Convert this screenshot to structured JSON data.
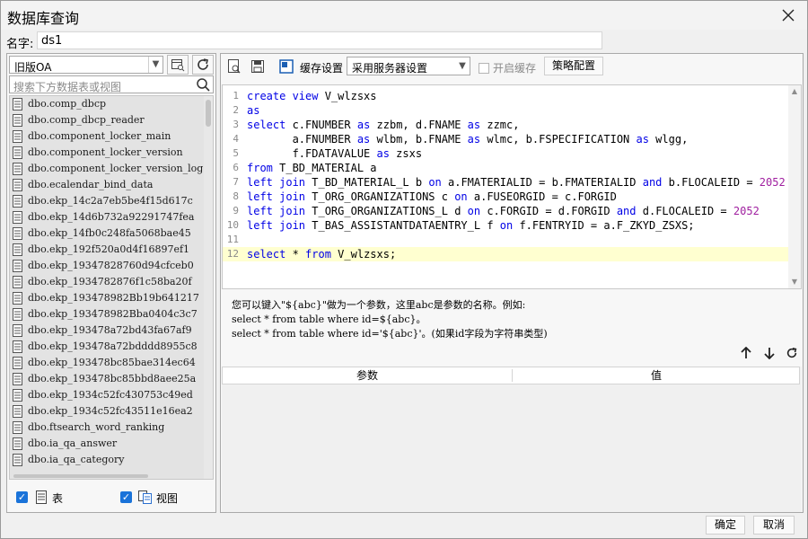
{
  "window": {
    "title": "数据库查询"
  },
  "name_field": {
    "label": "名字:",
    "value": "ds1"
  },
  "left_panel": {
    "db_select": "旧版OA",
    "search_placeholder": "搜索下方数据表或视图",
    "tables": [
      "dbo.comp_dbcp",
      "dbo.comp_dbcp_reader",
      "dbo.component_locker_main",
      "dbo.component_locker_version",
      "dbo.component_locker_version_log",
      "dbo.ecalendar_bind_data",
      "dbo.ekp_14c2a7eb5be4f15d617c",
      "dbo.ekp_14d6b732a92291747fea",
      "dbo.ekp_14fb0c248fa5068bae45",
      "dbo.ekp_192f520a0d4f16897ef1",
      "dbo.ekp_19347828760d94cfceb0",
      "dbo.ekp_1934782876f1c58ba20f",
      "dbo.ekp_193478982Bb19b641217",
      "dbo.ekp_193478982Bba0404c3c7",
      "dbo.ekp_193478a72bd43fa67af9",
      "dbo.ekp_193478a72bdddd8955c8",
      "dbo.ekp_193478bc85bae314ec64",
      "dbo.ekp_193478bc85bbd8aee25a",
      "dbo.ekp_1934c52fc430753c49ed",
      "dbo.ekp_1934c52fc43511e16ea2",
      "dbo.ftsearch_word_ranking",
      "dbo.ia_qa_answer",
      "dbo.ia_qa_category"
    ],
    "check_table": "表",
    "check_view": "视图"
  },
  "toolbar": {
    "cache_label": "缓存设置",
    "cache_select": "采用服务器设置",
    "open_cache": "开启缓存",
    "policy_button": "策略配置"
  },
  "editor": {
    "lines": [
      {
        "n": "1",
        "parts": [
          {
            "t": "create view",
            "c": "kw"
          },
          {
            "t": " V_wlzsxs"
          }
        ]
      },
      {
        "n": "2",
        "parts": [
          {
            "t": "as",
            "c": "kw"
          }
        ]
      },
      {
        "n": "3",
        "parts": [
          {
            "t": "select",
            "c": "kw"
          },
          {
            "t": " c.FNUMBER "
          },
          {
            "t": "as",
            "c": "kw"
          },
          {
            "t": " zzbm, d.FNAME "
          },
          {
            "t": "as",
            "c": "kw"
          },
          {
            "t": " zzmc,"
          }
        ]
      },
      {
        "n": "4",
        "parts": [
          {
            "t": "       a.FNUMBER "
          },
          {
            "t": "as",
            "c": "kw"
          },
          {
            "t": " wlbm, b.FNAME "
          },
          {
            "t": "as",
            "c": "kw"
          },
          {
            "t": " wlmc, b.FSPECIFICATION "
          },
          {
            "t": "as",
            "c": "kw"
          },
          {
            "t": " wlgg,"
          }
        ]
      },
      {
        "n": "5",
        "parts": [
          {
            "t": "       f.FDATAVALUE "
          },
          {
            "t": "as",
            "c": "kw"
          },
          {
            "t": " zsxs"
          }
        ]
      },
      {
        "n": "6",
        "parts": [
          {
            "t": "from",
            "c": "kw"
          },
          {
            "t": " T_BD_MATERIAL a"
          }
        ]
      },
      {
        "n": "7",
        "parts": [
          {
            "t": "left join",
            "c": "kw"
          },
          {
            "t": " T_BD_MATERIAL_L b "
          },
          {
            "t": "on",
            "c": "kw"
          },
          {
            "t": " a.FMATERIALID = b.FMATERIALID "
          },
          {
            "t": "and",
            "c": "kw"
          },
          {
            "t": " b.FLOCALEID = "
          },
          {
            "t": "2052",
            "c": "num"
          }
        ]
      },
      {
        "n": "8",
        "parts": [
          {
            "t": "left join",
            "c": "kw"
          },
          {
            "t": " T_ORG_ORGANIZATIONS c "
          },
          {
            "t": "on",
            "c": "kw"
          },
          {
            "t": " a.FUSEORGID = c.FORGID"
          }
        ]
      },
      {
        "n": "9",
        "parts": [
          {
            "t": "left join",
            "c": "kw"
          },
          {
            "t": " T_ORG_ORGANIZATIONS_L d "
          },
          {
            "t": "on",
            "c": "kw"
          },
          {
            "t": " c.FORGID = d.FORGID "
          },
          {
            "t": "and",
            "c": "kw"
          },
          {
            "t": " d.FLOCALEID = "
          },
          {
            "t": "2052",
            "c": "num"
          }
        ]
      },
      {
        "n": "10",
        "parts": [
          {
            "t": "left join",
            "c": "kw"
          },
          {
            "t": " T_BAS_ASSISTANTDATAENTRY_L f "
          },
          {
            "t": "on",
            "c": "kw"
          },
          {
            "t": " f.FENTRYID = a.F_ZKYD_ZSXS;"
          }
        ]
      },
      {
        "n": "11",
        "parts": []
      },
      {
        "n": "12",
        "parts": [
          {
            "t": "select",
            "c": "kw"
          },
          {
            "t": " * "
          },
          {
            "t": "from",
            "c": "kw"
          },
          {
            "t": " V_wlzsxs;"
          }
        ],
        "active": true
      }
    ]
  },
  "help": {
    "line1": "您可以键入\"${abc}\"做为一个参数，这里abc是参数的名称。例如:",
    "line2": "select * from table where id=${abc}。",
    "line3": "select * from table where id='${abc}'。(如果id字段为字符串类型)"
  },
  "params": {
    "col_param": "参数",
    "col_value": "值"
  },
  "footer": {
    "ok": "确定",
    "cancel": "取消"
  },
  "colors": {
    "keyword": "#0000e6",
    "number": "#a020a0",
    "active_line": "#ffffd0",
    "checkbox": "#1a73d9"
  }
}
